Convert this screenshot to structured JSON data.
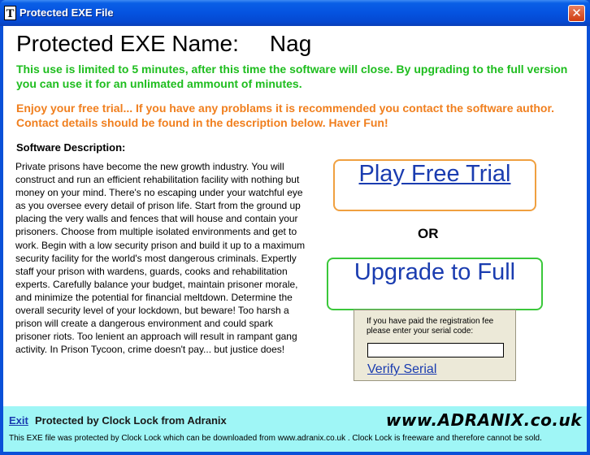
{
  "window": {
    "title": "Protected EXE File",
    "icon_letter": "T",
    "close_glyph": "✕"
  },
  "header": {
    "name_label": "Protected EXE Name:",
    "name_value": "Nag"
  },
  "messages": {
    "limit": "This use is limited to 5 minutes, after this time the software will close.  By upgrading to the full version you can use it for an unlimated ammount of minutes.",
    "trial": "Enjoy your free trial... If you have any problams it is recommended you contact the software author.  Contact details should be found in the description below.  Haver Fun!"
  },
  "description": {
    "title": "Software Description:",
    "text": "Private prisons have become the new growth industry. You will construct and run an efficient rehabilitation facility with nothing but money on your mind. There's no escaping under your watchful eye as you oversee every detail of prison life. Start from the ground up placing the very walls and fences that will house and contain your prisoners. Choose from multiple isolated environments and get to work. Begin with a low security prison and build it up to a maximum security facility for the world's most dangerous criminals. Expertly staff your prison with wardens, guards, cooks and rehabilitation experts. Carefully balance your budget, maintain prisoner morale, and minimize the potential for financial meltdown. Determine the overall security level of your lockdown, but beware! Too harsh a prison will create a dangerous environment and could spark prisoner riots. Too lenient an approach will result in rampant gang activity. In Prison Tycoon, crime doesn't pay... but justice does!"
  },
  "actions": {
    "play_label": "Play Free Trial",
    "or_label": "OR",
    "upgrade_label": "Upgrade to Full"
  },
  "serial": {
    "prompt": "If you have paid the registration fee please enter your serial code:",
    "value": "",
    "verify_label": "Verify Serial"
  },
  "footer": {
    "exit_label": "Exit",
    "protected_by": "Protected by Clock Lock from Adranix",
    "brand": "www.ADRANIX.co.uk",
    "note": "This EXE file was protected by Clock Lock which can be downloaded from www.adranix.co.uk .  Clock Lock is freeware and therefore cannot be sold."
  },
  "colors": {
    "limit_text": "#1ebd1e",
    "trial_text": "#f07f1e",
    "link": "#1a3cb0",
    "footer_bg": "#9ff6f6",
    "play_border": "#f0a040",
    "upgrade_border": "#3ac83a"
  }
}
